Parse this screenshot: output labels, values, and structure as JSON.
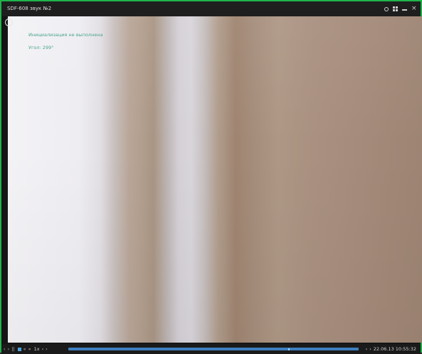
{
  "window": {
    "title": "SDF-608 звук №2"
  },
  "title_controls": [
    {
      "name": "gear-icon"
    },
    {
      "name": "layout-icon"
    },
    {
      "name": "minimize-icon"
    },
    {
      "name": "close-icon"
    }
  ],
  "video": {
    "overlay_line1": "Инициализация не выполнена",
    "overlay_line2": "Угол: 299°"
  },
  "controls": {
    "prev_frame": "‹",
    "play": "›",
    "pause": "||",
    "rewind": "«",
    "fast_forward": "»",
    "speed": "1x",
    "step_back": "‹",
    "step_forward": "›",
    "timestamp": "22.06.13 10:55:32",
    "nav_left": "‹",
    "nav_right": "›"
  },
  "colors": {
    "border_accent": "#1fb34a",
    "timeline": "#3d7fbf",
    "overlay_text": "#4aa58c"
  }
}
